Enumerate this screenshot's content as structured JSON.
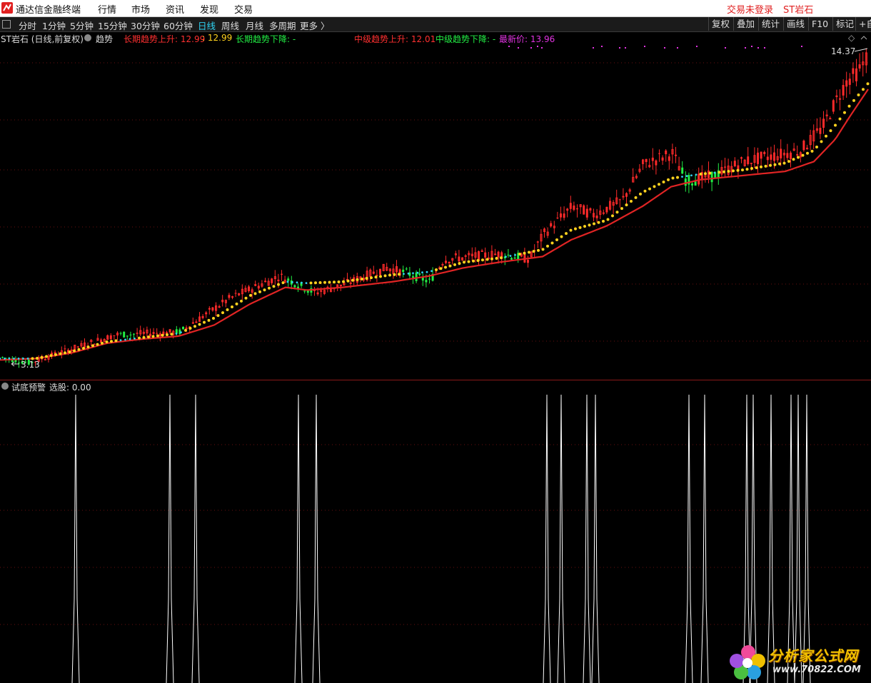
{
  "app": {
    "title": "通达信金融终端"
  },
  "menu": [
    "行情",
    "市场",
    "资讯",
    "发现",
    "交易"
  ],
  "status": {
    "login": "交易未登录",
    "stock": "ST岩石"
  },
  "periods": [
    "分时",
    "1分钟",
    "5分钟",
    "15分钟",
    "30分钟",
    "60分钟",
    "日线",
    "周线",
    "月线",
    "多周期",
    "更多 〉"
  ],
  "active_period": "日线",
  "tools": [
    "复权",
    "叠加",
    "统计",
    "画线",
    "F10",
    "标记",
    "+自"
  ],
  "info": {
    "title": "ST岩石 (日线,前复权)",
    "indicator": "趋势",
    "long_up_label": "长期趋势上升: 12.99",
    "long_up_value": ": 12.99",
    "long_down_label": "长期趋势下降: -",
    "mid_up_label": "中级趋势上升: 12.01",
    "mid_down_label": "中级趋势下降: -",
    "latest_label": "最新价: 13.96",
    "max_price_label": "14.37",
    "min_price_label": "3.13",
    "diamond": "◇"
  },
  "lower": {
    "indicator": "试底预警",
    "select_label": "选股: 0.00"
  },
  "watermark": {
    "text": "分析家公式网",
    "url": "www.70822.COM"
  },
  "colors": {
    "up": "#ff2a2a",
    "down": "#22ee44",
    "ma_dots": "#ffd21e",
    "long_line": "#e02424",
    "highlight": "#2fd3f3",
    "magenta": "#e033e0",
    "signal": "#ffffff"
  },
  "chart_data": [
    {
      "type": "candlestick",
      "title": "ST岩石 (日线,前复权)",
      "price_range": [
        3.13,
        14.37
      ],
      "last_price": 13.96,
      "close_trend": [
        [
          0,
          3.4
        ],
        [
          40,
          3.2
        ],
        [
          100,
          3.7
        ],
        [
          160,
          4.2
        ],
        [
          250,
          4.3
        ],
        [
          320,
          5.5
        ],
        [
          390,
          6.3
        ],
        [
          400,
          6.2
        ],
        [
          440,
          5.7
        ],
        [
          480,
          6.0
        ],
        [
          540,
          6.6
        ],
        [
          570,
          6.4
        ],
        [
          600,
          6.1
        ],
        [
          620,
          6.9
        ],
        [
          700,
          7.1
        ],
        [
          740,
          6.9
        ],
        [
          760,
          7.8
        ],
        [
          800,
          8.8
        ],
        [
          830,
          8.5
        ],
        [
          870,
          9.0
        ],
        [
          900,
          10.3
        ],
        [
          940,
          10.7
        ],
        [
          960,
          9.7
        ],
        [
          1000,
          9.9
        ],
        [
          1040,
          10.4
        ],
        [
          1080,
          10.6
        ],
        [
          1120,
          10.8
        ],
        [
          1150,
          11.6
        ],
        [
          1170,
          12.6
        ],
        [
          1185,
          13.3
        ],
        [
          1200,
          13.6
        ],
        [
          1210,
          14.0
        ],
        [
          1216,
          14.37
        ]
      ],
      "long_trend": [
        [
          0,
          3.3
        ],
        [
          50,
          3.35
        ],
        [
          100,
          3.55
        ],
        [
          150,
          3.9
        ],
        [
          200,
          4.05
        ],
        [
          250,
          4.15
        ],
        [
          300,
          4.55
        ],
        [
          350,
          5.3
        ],
        [
          400,
          5.9
        ],
        [
          430,
          5.8
        ],
        [
          480,
          5.9
        ],
        [
          550,
          6.1
        ],
        [
          600,
          6.3
        ],
        [
          650,
          6.6
        ],
        [
          700,
          6.8
        ],
        [
          760,
          7.0
        ],
        [
          800,
          7.6
        ],
        [
          850,
          8.1
        ],
        [
          900,
          8.8
        ],
        [
          940,
          9.5
        ],
        [
          980,
          9.75
        ],
        [
          1040,
          9.9
        ],
        [
          1100,
          10.05
        ],
        [
          1140,
          10.4
        ],
        [
          1170,
          11.2
        ],
        [
          1190,
          12.0
        ],
        [
          1216,
          12.99
        ]
      ],
      "mid_trend": [
        [
          0,
          3.35
        ],
        [
          50,
          3.35
        ],
        [
          100,
          3.6
        ],
        [
          150,
          3.95
        ],
        [
          200,
          4.1
        ],
        [
          250,
          4.25
        ],
        [
          300,
          4.8
        ],
        [
          350,
          5.6
        ],
        [
          400,
          6.1
        ],
        [
          430,
          6.05
        ],
        [
          480,
          6.1
        ],
        [
          550,
          6.35
        ],
        [
          600,
          6.45
        ],
        [
          650,
          6.8
        ],
        [
          700,
          6.95
        ],
        [
          760,
          7.25
        ],
        [
          800,
          7.95
        ],
        [
          850,
          8.3
        ],
        [
          900,
          9.3
        ],
        [
          940,
          9.8
        ],
        [
          980,
          9.95
        ],
        [
          1040,
          10.1
        ],
        [
          1100,
          10.35
        ],
        [
          1140,
          10.8
        ],
        [
          1170,
          11.7
        ],
        [
          1190,
          12.4
        ],
        [
          1216,
          13.2
        ]
      ],
      "down_segments": [
        [
          0,
          45
        ],
        [
          165,
          190
        ],
        [
          245,
          255
        ],
        [
          400,
          435
        ],
        [
          560,
          605
        ],
        [
          705,
          725
        ],
        [
          950,
          975
        ],
        [
          995,
          1005
        ]
      ]
    },
    {
      "type": "signal",
      "title": "试底预警",
      "value": 0.0,
      "signal_x": [
        106,
        238,
        274,
        418,
        443,
        766,
        786,
        822,
        834,
        965,
        987,
        1046,
        1055,
        1080,
        1108,
        1118,
        1130
      ]
    }
  ]
}
